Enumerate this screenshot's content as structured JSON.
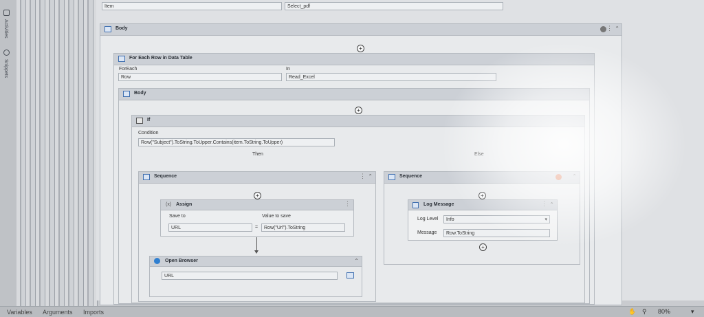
{
  "top_row": {
    "left_label": "Item",
    "right_value": "Select_pdf"
  },
  "left_rail": {
    "tab1": "Activities",
    "tab2": "Snippets"
  },
  "body_outer": {
    "title": "Body"
  },
  "for_each": {
    "title": "For Each Row in Data Table",
    "foreach_label": "ForEach",
    "foreach_value": "Row",
    "in_label": "In",
    "in_value": "Read_Excel"
  },
  "body_inner": {
    "title": "Body"
  },
  "if_block": {
    "title": "If",
    "condition_label": "Condition",
    "condition_value": "Row(\"Subject\").ToString.ToUpper.Contains(item.ToString.ToUpper)",
    "then_label": "Then",
    "else_label": "Else"
  },
  "then_sequence": {
    "title": "Sequence",
    "assign": {
      "title": "Assign",
      "save_to_label": "Save to",
      "value_label": "Value to save",
      "save_to_value": "URL",
      "equals": "=",
      "value": "Row(\"Url\").ToString"
    },
    "open_browser": {
      "title": "Open Browser",
      "url_value": "URL"
    }
  },
  "else_sequence": {
    "title": "Sequence",
    "log_message": {
      "title": "Log Message",
      "level_label": "Log Level",
      "level_value": "Info",
      "message_label": "Message",
      "message_value": "Row.ToString"
    }
  },
  "status_bar": {
    "variables": "Variables",
    "arguments": "Arguments",
    "imports": "Imports",
    "zoom": "80%"
  },
  "glyphs": {
    "plus": "+",
    "kebab": "⋮",
    "collapse": "⌃",
    "arrow": "▾",
    "assign_code": "(x)"
  },
  "colors": {
    "accent": "#3f6fb0",
    "warning": "#d9663a"
  }
}
